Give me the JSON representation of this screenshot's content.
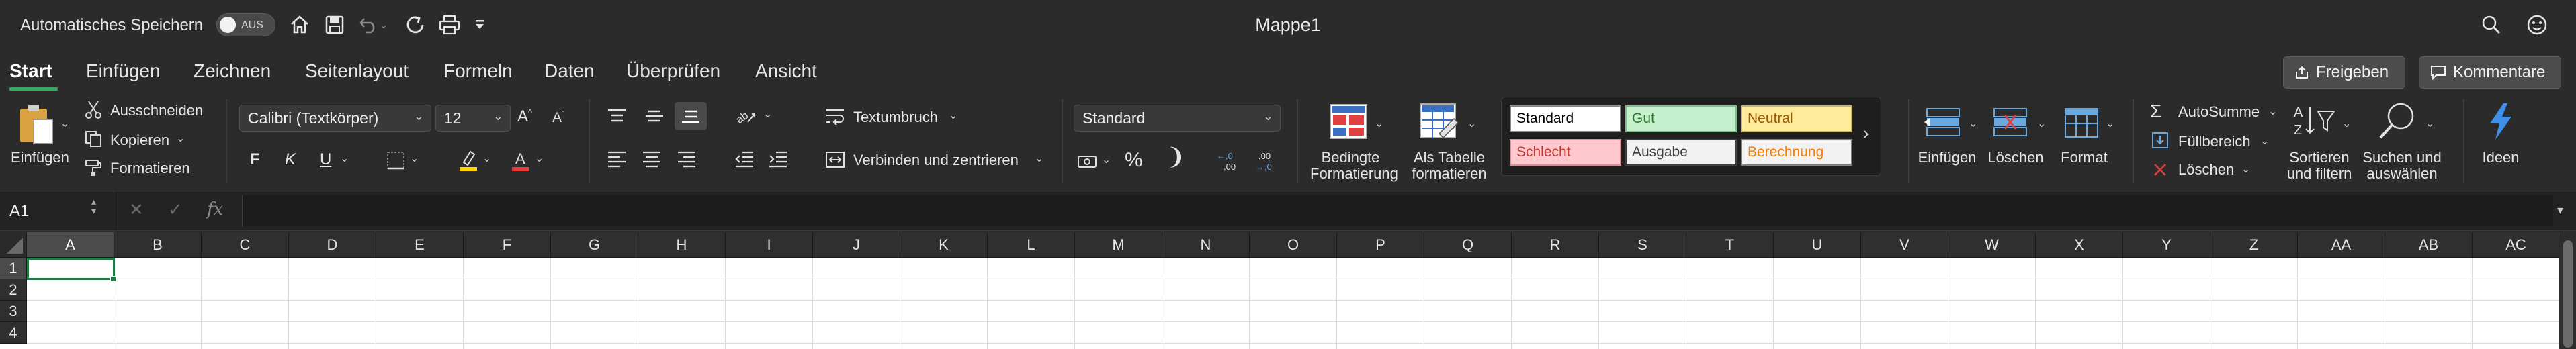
{
  "titlebar": {
    "autosave_label": "Automatisches Speichern",
    "autosave_state": "AUS",
    "document_title": "Mappe1",
    "icons": [
      "home-icon",
      "save-icon",
      "undo-icon",
      "redo-icon",
      "print-icon",
      "customize-icon",
      "search-icon",
      "feedback-icon"
    ]
  },
  "tabs": [
    "Start",
    "Einfügen",
    "Zeichnen",
    "Seitenlayout",
    "Formeln",
    "Daten",
    "Überprüfen",
    "Ansicht"
  ],
  "active_tab": "Start",
  "share": {
    "label": "Freigeben"
  },
  "comments": {
    "label": "Kommentare"
  },
  "clipboard": {
    "paste": "Einfügen",
    "cut": "Ausschneiden",
    "copy": "Kopieren",
    "format_painter": "Formatieren"
  },
  "font": {
    "family": "Calibri (Textkörper)",
    "size": "12",
    "bold": "F",
    "italic": "K",
    "underline": "U",
    "highlight_color": "#ffd400",
    "font_color": "#e23b3b"
  },
  "alignment": {
    "wrap_text": "Textumbruch",
    "merge_center": "Verbinden und zentrieren"
  },
  "number": {
    "format": "Standard",
    "percent": "%",
    "comma": "⁾",
    "increase_decimal": "←,0 ,00",
    "decrease_decimal": ",00 →,0"
  },
  "conditional": {
    "conditional_formatting_1": "Bedingte",
    "conditional_formatting_2": "Formatierung",
    "format_as_table_1": "Als Tabelle",
    "format_as_table_2": "formatieren"
  },
  "styles": {
    "row1": [
      {
        "name": "Standard",
        "bg": "#ffffff",
        "fg": "#000000",
        "border": "#888888"
      },
      {
        "name": "Gut",
        "bg": "#c6efce",
        "fg": "#2e7d32",
        "border": "#7fbf8a"
      },
      {
        "name": "Neutral",
        "bg": "#ffeb9c",
        "fg": "#9c5700",
        "border": "#c9b26b"
      }
    ],
    "row2": [
      {
        "name": "Schlecht",
        "bg": "#ffc7ce",
        "fg": "#c0392b",
        "border": "#d98f98"
      },
      {
        "name": "Ausgabe",
        "bg": "#f2f2f2",
        "fg": "#3f3f3f",
        "border": "#3f3f3f"
      },
      {
        "name": "Berechnung",
        "bg": "#f2f2f2",
        "fg": "#fa7d00",
        "border": "#7f7f7f"
      }
    ]
  },
  "cells_group": {
    "insert": "Einfügen",
    "delete": "Löschen",
    "format": "Format"
  },
  "editing": {
    "autosum": "AutoSumme",
    "fill": "Füllbereich",
    "clear": "Löschen",
    "sort_filter_1": "Sortieren",
    "sort_filter_2": "und filtern",
    "find_select_1": "Suchen und",
    "find_select_2": "auswählen"
  },
  "ideas": {
    "label": "Ideen"
  },
  "formula_bar": {
    "name_box": "A1",
    "fx": "fx",
    "value": ""
  },
  "grid": {
    "columns": [
      "A",
      "B",
      "C",
      "D",
      "E",
      "F",
      "G",
      "H",
      "I",
      "J",
      "K",
      "L",
      "M",
      "N",
      "O",
      "P",
      "Q",
      "R",
      "S",
      "T",
      "U",
      "V",
      "W",
      "X",
      "Y",
      "Z",
      "AA",
      "AB",
      "AC"
    ],
    "rows": [
      "1",
      "2",
      "3",
      "4"
    ],
    "selected_cell": "A1"
  },
  "colors": {
    "accent_green": "#1f7a45",
    "tab_underline": "#3fa964",
    "ideas_blue": "#3d8fe8"
  }
}
